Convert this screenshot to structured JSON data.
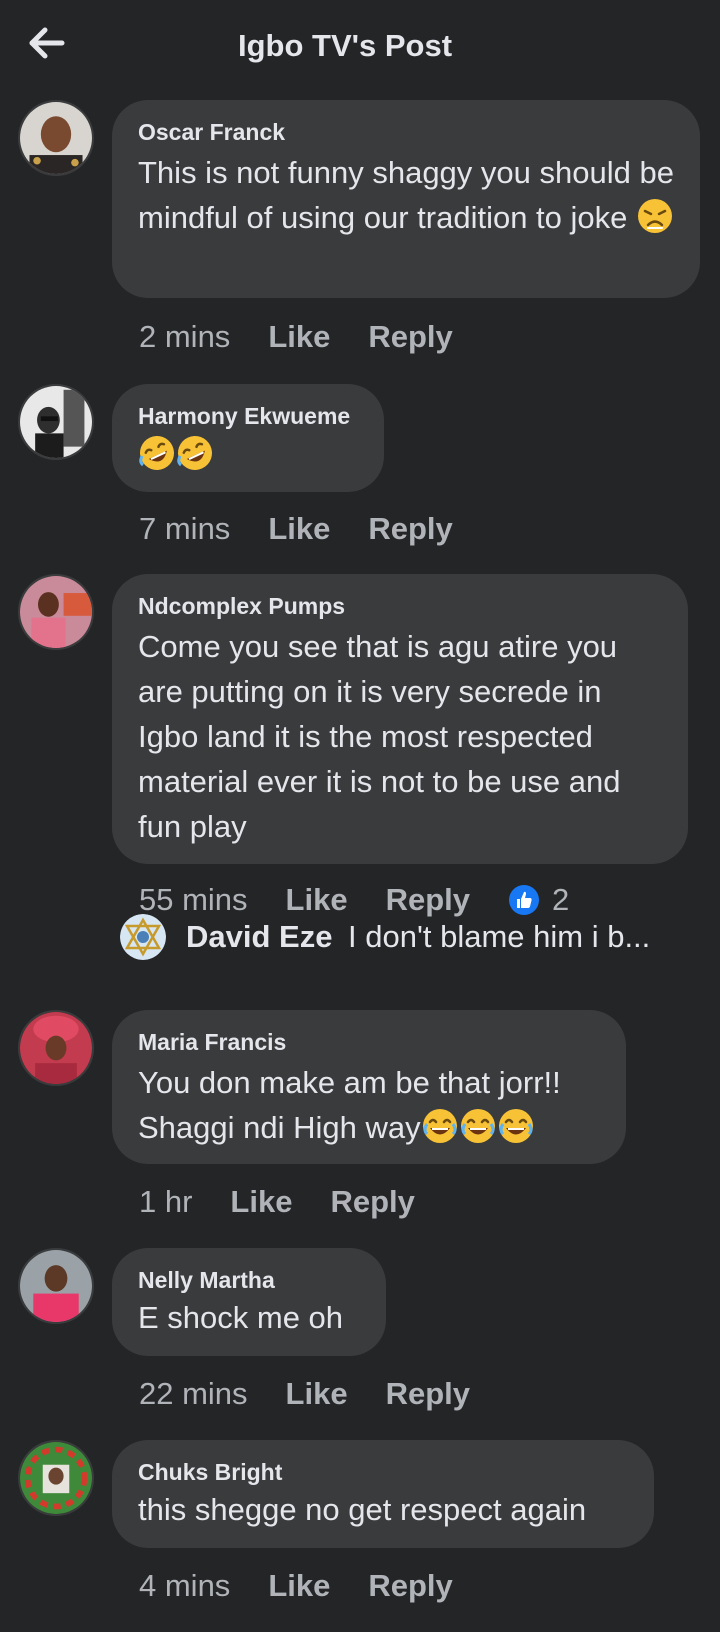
{
  "header": {
    "title": "Igbo TV's Post",
    "back_icon": "arrow-left-icon"
  },
  "comments": [
    {
      "author": "Oscar Franck",
      "text": "This is not funny shaggy you should be mindful of using our tradition to joke",
      "emoji": [
        "persevering-face"
      ],
      "time": "2 mins",
      "like_label": "Like",
      "reply_label": "Reply"
    },
    {
      "author": "Harmony Ekwueme",
      "text": "",
      "emoji": [
        "rolling-on-floor-laughing",
        "rolling-on-floor-laughing"
      ],
      "time": "7 mins",
      "like_label": "Like",
      "reply_label": "Reply"
    },
    {
      "author": "Ndcomplex Pumps",
      "text": "Come you see that is agu atire you are putting on it is very secrede in Igbo land it is the most respected material ever it is not to be use and fun play",
      "time": "55 mins",
      "like_label": "Like",
      "reply_label": "Reply",
      "reaction_icon": "thumbs-up-icon",
      "reaction_count": "2",
      "reply_preview": {
        "author": "David Eze",
        "text": "I don't blame him i b..."
      }
    },
    {
      "author": "Maria Francis",
      "text_line1": "You don make am be that jorr!!",
      "text_line2": "Shaggi ndi High way",
      "emoji": [
        "face-with-tears-of-joy",
        "face-with-tears-of-joy",
        "face-with-tears-of-joy"
      ],
      "time": "1 hr",
      "like_label": "Like",
      "reply_label": "Reply"
    },
    {
      "author": "Nelly Martha",
      "text": "E shock me oh",
      "time": "22 mins",
      "like_label": "Like",
      "reply_label": "Reply"
    },
    {
      "author": "Chuks Bright",
      "text": "this shegge no get respect again",
      "time": "4 mins",
      "like_label": "Like",
      "reply_label": "Reply"
    }
  ],
  "colors": {
    "background": "#242527",
    "bubble": "#3a3b3c",
    "primary_text": "#e4e6eb",
    "secondary_text": "#b0b3b8",
    "like_blue": "#1877f2"
  }
}
